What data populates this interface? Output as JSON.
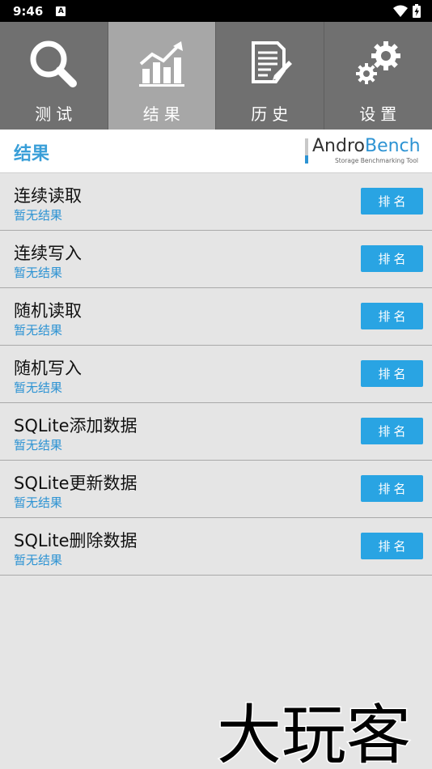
{
  "status_bar": {
    "time": "9:46",
    "notification_icon": "A"
  },
  "tabs": [
    {
      "label": "测试",
      "icon": "search-icon"
    },
    {
      "label": "结果",
      "icon": "chart-icon",
      "active": true
    },
    {
      "label": "历史",
      "icon": "document-edit-icon"
    },
    {
      "label": "设置",
      "icon": "gears-icon"
    }
  ],
  "header": {
    "title": "结果",
    "logo_part1": "Andro",
    "logo_part2": "Bench",
    "logo_tagline": "Storage Benchmarking Tool"
  },
  "results": [
    {
      "title": "连续读取",
      "status": "暂无结果",
      "button": "排名"
    },
    {
      "title": "连续写入",
      "status": "暂无结果",
      "button": "排名"
    },
    {
      "title": "随机读取",
      "status": "暂无结果",
      "button": "排名"
    },
    {
      "title": "随机写入",
      "status": "暂无结果",
      "button": "排名"
    },
    {
      "title": "SQLite添加数据",
      "status": "暂无结果",
      "button": "排名"
    },
    {
      "title": "SQLite更新数据",
      "status": "暂无结果",
      "button": "排名"
    },
    {
      "title": "SQLite删除数据",
      "status": "暂无结果",
      "button": "排名"
    }
  ],
  "watermark": "大玩客",
  "colors": {
    "accent": "#2d93d3",
    "button": "#29a4e3",
    "tab_bg": "#707070",
    "tab_active": "#a7a7a7"
  }
}
